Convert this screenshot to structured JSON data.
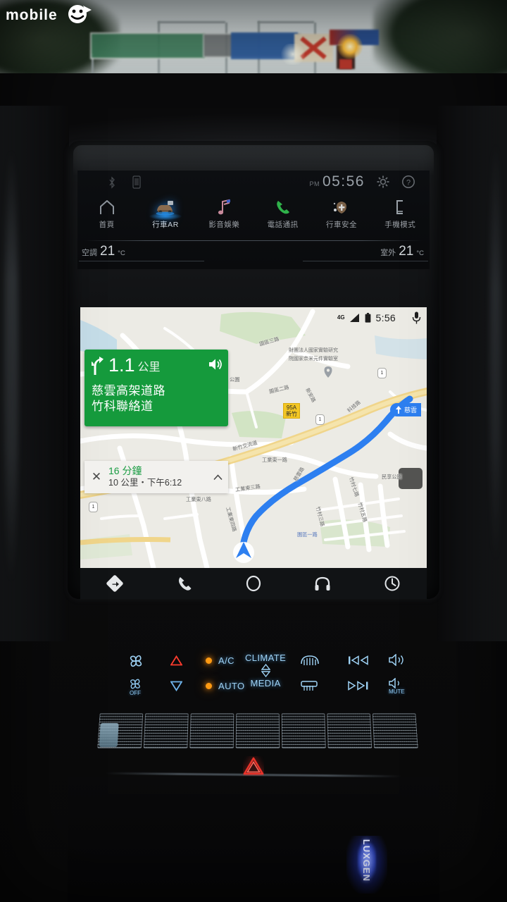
{
  "watermark": {
    "text": "mobile01"
  },
  "exterior": {
    "description": "dusk highway view through windshield with overhead sign gantry"
  },
  "head_unit": {
    "status": {
      "bluetooth_icon": "bluetooth-icon",
      "phone_icon": "phone-connected-icon",
      "am_pm": "PM",
      "time": "05:56",
      "settings_icon": "gear-icon",
      "help_icon": "help-icon"
    },
    "menu": [
      {
        "label": "首頁",
        "icon": "home-icon",
        "active": false
      },
      {
        "label": "行車AR",
        "icon": "car-ar-icon",
        "active": true
      },
      {
        "label": "影音娛樂",
        "icon": "music-note-icon",
        "active": false
      },
      {
        "label": "電話通訊",
        "icon": "phone-handset-icon",
        "active": false
      },
      {
        "label": "行車安全",
        "icon": "safety-icon",
        "active": false
      },
      {
        "label": "手機模式",
        "icon": "phone-mode-icon",
        "active": false
      }
    ],
    "climate_readout": {
      "cabin_label": "空調",
      "cabin_value": "21",
      "cabin_unit": "°C",
      "outside_label": "室外",
      "outside_value": "21",
      "outside_unit": "°C"
    }
  },
  "android_auto": {
    "status_bar": {
      "network": "4G",
      "signal_icon": "signal-bars-icon",
      "battery_icon": "battery-icon",
      "time": "5:56",
      "mic_icon": "microphone-icon"
    },
    "guidance_card": {
      "maneuver_icon": "turn-slight-right-icon",
      "distance": "1.1",
      "distance_unit": "公里",
      "speaker_icon": "volume-on-icon",
      "road_primary": "慈雲高架道路",
      "road_secondary": "竹科聯絡道",
      "bg_color": "#159a3c"
    },
    "eta_bar": {
      "close_icon": "close-icon",
      "duration": "16 分鐘",
      "detail": "10 公里・下午6:12",
      "expand_icon": "chevron-up-icon",
      "duration_color": "#1a9c43"
    },
    "nav_bar": [
      {
        "icon": "navigation-diamond-icon",
        "name": "navigation"
      },
      {
        "icon": "phone-handset-icon",
        "name": "phone"
      },
      {
        "icon": "home-circle-icon",
        "name": "home"
      },
      {
        "icon": "headphones-icon",
        "name": "media"
      },
      {
        "icon": "recent-clock-icon",
        "name": "recents"
      }
    ],
    "map": {
      "route_color": "#2d7ff0",
      "position_marker": "navigation-arrow-icon",
      "exit_marker": {
        "number": "95A",
        "place": "新竹"
      },
      "direction_badge": "慈雲",
      "highway_shields": [
        "1",
        "1",
        "1"
      ],
      "poi_label_line1": "財團法人國家實驗研究",
      "poi_label_line2": "院國家奈米元件實驗室",
      "labels": [
        "園區三路",
        "園區二路",
        "新安路",
        "公園",
        "科技路",
        "新竹交流道",
        "工業東一路",
        "工業東三路",
        "工業東八路",
        "民享公園",
        "園區一路",
        "竹村七路",
        "竹村五路",
        "竹村三路",
        "慈雲路",
        "工業東四路",
        "園區二路"
      ]
    }
  },
  "climate_panel": {
    "fan_icon": "fan-icon",
    "fan_off_label": "OFF",
    "temp_up_icon": "triangle-up-red-icon",
    "temp_down_icon": "triangle-down-blue-icon",
    "ac_label": "A/C",
    "ac_led_on": true,
    "auto_label": "AUTO",
    "auto_led_on": true,
    "climate_label": "CLIMATE",
    "climate_up_icon": "triangle-up-icon",
    "media_down_icon": "triangle-down-icon",
    "media_label": "MEDIA",
    "rear_defrost_icon": "rear-defrost-icon",
    "front_defrost_icon": "front-defrost-icon",
    "prev_track_icon": "previous-track-icon",
    "next_track_icon": "next-track-icon",
    "volume_up_icon": "volume-up-icon",
    "mute_icon": "volume-mute-icon",
    "mute_label": "MUTE",
    "led_color": "#ff9a12",
    "label_color": "#9ed2f5"
  },
  "console": {
    "speaker_grille_segments": 7,
    "hazard_icon": "hazard-triangle-icon",
    "hazard_color": "#e8332a",
    "cupholder_light": "blue-illumination",
    "cupholder_text": "LUXGEN"
  }
}
